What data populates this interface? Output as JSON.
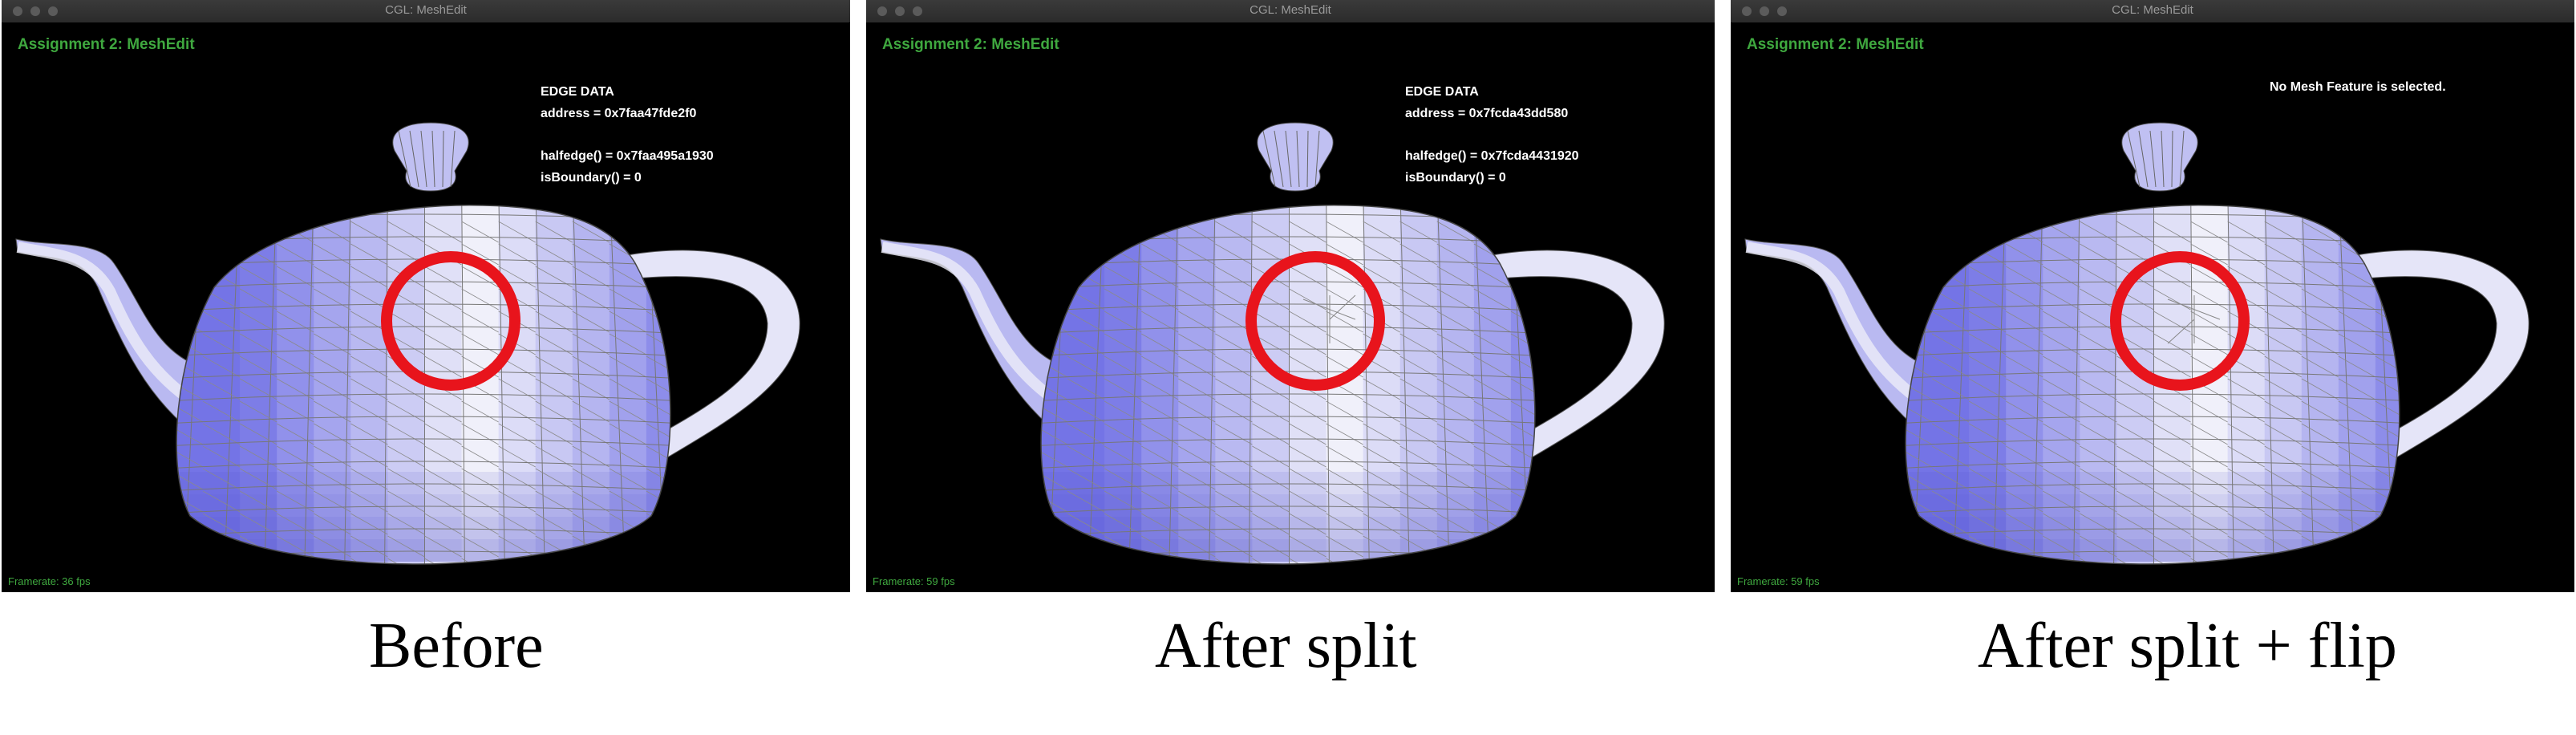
{
  "window_title": "CGL: MeshEdit",
  "app_title": "Assignment 2: MeshEdit",
  "panels": [
    {
      "framerate": "Framerate: 36 fps",
      "edge": {
        "header": "EDGE DATA",
        "address": "address       = 0x7faa47fde2f0",
        "halfedge": "halfedge()    = 0x7faa495a1930",
        "boundary": "isBoundary() = 0"
      },
      "caption": "Before"
    },
    {
      "framerate": "Framerate: 59 fps",
      "edge": {
        "header": "EDGE DATA",
        "address": "address       = 0x7fcda43dd580",
        "halfedge": "halfedge()    = 0x7fcda4431920",
        "boundary": "isBoundary() = 0"
      },
      "caption": "After split"
    },
    {
      "framerate": "Framerate: 59 fps",
      "no_selection": "No Mesh Feature is selected.",
      "caption": "After split + flip"
    }
  ],
  "colors": {
    "mesh_light": "#f2f2fa",
    "mesh_dark": "#7474e6",
    "highlight_circle": "#e8141c",
    "hud_green": "#3fa83f"
  }
}
